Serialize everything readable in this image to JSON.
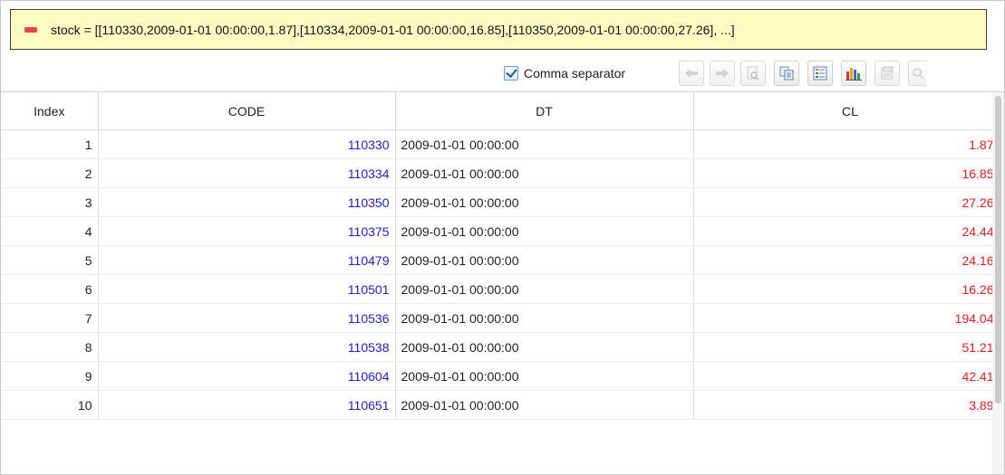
{
  "variable": {
    "text": "stock = [[110330,2009-01-01 00:00:00,1.87],[110334,2009-01-01 00:00:00,16.85],[110350,2009-01-01 00:00:00,27.26], ...]"
  },
  "toolbar": {
    "comma_label": "Comma separator",
    "comma_checked": true
  },
  "table": {
    "headers": [
      "Index",
      "CODE",
      "DT",
      "CL"
    ],
    "rows": [
      {
        "index": "1",
        "code": "110330",
        "dt": "2009-01-01 00:00:00",
        "cl": "1.87"
      },
      {
        "index": "2",
        "code": "110334",
        "dt": "2009-01-01 00:00:00",
        "cl": "16.85"
      },
      {
        "index": "3",
        "code": "110350",
        "dt": "2009-01-01 00:00:00",
        "cl": "27.26"
      },
      {
        "index": "4",
        "code": "110375",
        "dt": "2009-01-01 00:00:00",
        "cl": "24.44"
      },
      {
        "index": "5",
        "code": "110479",
        "dt": "2009-01-01 00:00:00",
        "cl": "24.16"
      },
      {
        "index": "6",
        "code": "110501",
        "dt": "2009-01-01 00:00:00",
        "cl": "16.26"
      },
      {
        "index": "7",
        "code": "110536",
        "dt": "2009-01-01 00:00:00",
        "cl": "194.04"
      },
      {
        "index": "8",
        "code": "110538",
        "dt": "2009-01-01 00:00:00",
        "cl": "51.21"
      },
      {
        "index": "9",
        "code": "110604",
        "dt": "2009-01-01 00:00:00",
        "cl": "42.41"
      },
      {
        "index": "10",
        "code": "110651",
        "dt": "2009-01-01 00:00:00",
        "cl": "3.89"
      }
    ]
  },
  "colors": {
    "code_text": "#2020e0",
    "value_text": "#ee1b1b",
    "banner_bg": "#fdfcc3"
  }
}
